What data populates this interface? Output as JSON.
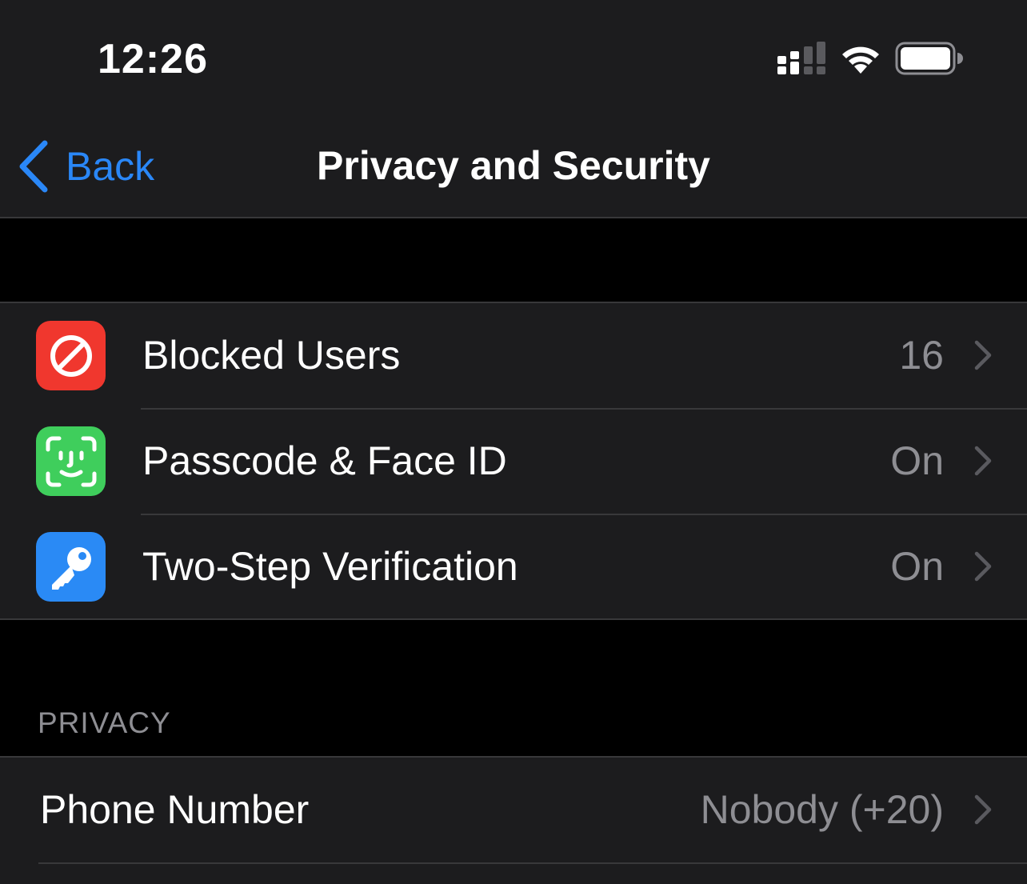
{
  "status_bar": {
    "time": "12:26",
    "signal_icon": "cellular-signal-icon",
    "wifi_icon": "wifi-icon",
    "battery_icon": "battery-icon"
  },
  "nav": {
    "back_label": "Back",
    "back_icon": "chevron-left-icon",
    "title": "Privacy and Security"
  },
  "security_rows": [
    {
      "label": "Blocked Users",
      "value": "16",
      "icon": "blocked-icon",
      "icon_bg": "#f0372e"
    },
    {
      "label": "Passcode & Face ID",
      "value": "On",
      "icon": "face-id-icon",
      "icon_bg": "#3fce5c"
    },
    {
      "label": "Two-Step Verification",
      "value": "On",
      "icon": "key-icon",
      "icon_bg": "#2a8af5"
    }
  ],
  "privacy_section": {
    "header": "PRIVACY",
    "rows": [
      {
        "label": "Phone Number",
        "value": "Nobody (+20)"
      }
    ]
  },
  "colors": {
    "background": "#000000",
    "cell_background": "#1c1c1e",
    "accent": "#2a87f7",
    "secondary_text": "#8e8e93",
    "separator": "#38383a"
  }
}
